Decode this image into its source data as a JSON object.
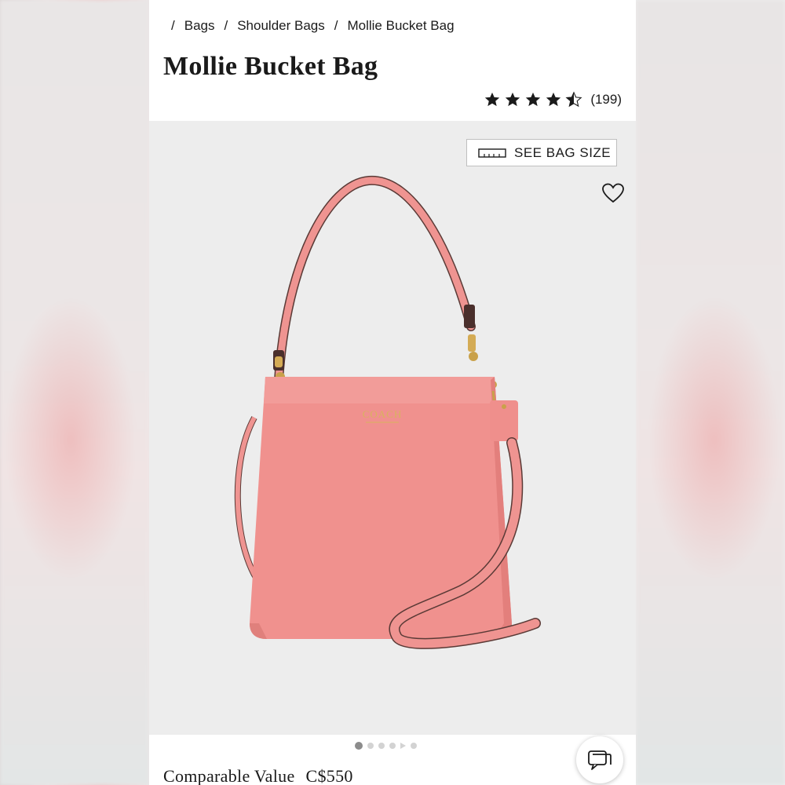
{
  "breadcrumb": {
    "items": [
      {
        "label": "Bags"
      },
      {
        "label": "Shoulder Bags"
      },
      {
        "label": "Mollie Bucket Bag"
      }
    ],
    "separator": "/"
  },
  "product": {
    "title": "Mollie Bucket Bag",
    "rating": 4.5,
    "review_count": "(199)",
    "bag_size_label": "SEE BAG SIZE",
    "brand_logo_text": "COACH",
    "price_label": "Comparable Value",
    "price_value": "C$550"
  },
  "gallery": {
    "total_slides": 6,
    "active_slide": 1
  },
  "colors": {
    "bag": "#ef9491",
    "accent_text": "#1b1b1b",
    "gallery_bg": "#ededed"
  },
  "icons": {
    "heart": "heart-icon",
    "ruler": "ruler-icon",
    "chat": "chat-icon",
    "star": "star-icon"
  }
}
